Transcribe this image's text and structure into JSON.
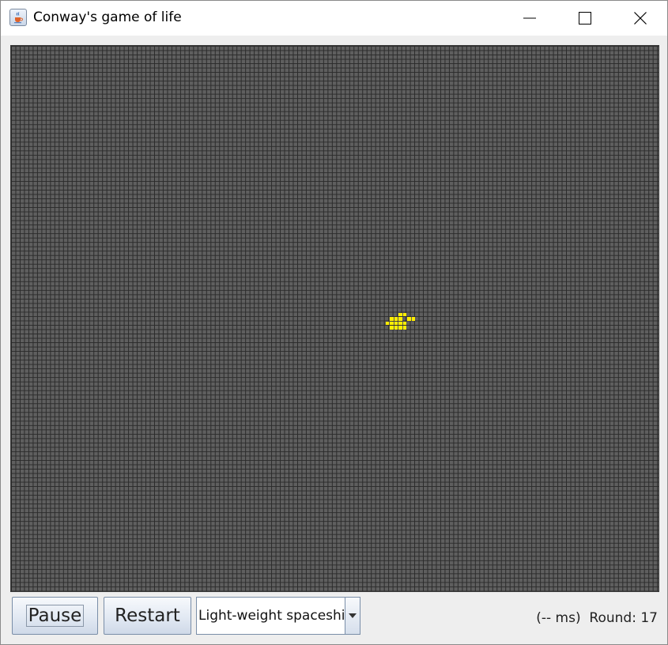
{
  "window": {
    "title": "Conway's game of life",
    "icon": "java-coffee-cup-icon",
    "controls": [
      "minimize-icon",
      "maximize-icon",
      "close-icon"
    ]
  },
  "board": {
    "columns": 149,
    "rows": 125,
    "dead_color": "#5f5f5f",
    "grid_color": "#2b2b2b",
    "live_color": "#ffee00",
    "live_cells": [
      [
        89,
        61
      ],
      [
        90,
        61
      ],
      [
        87,
        62
      ],
      [
        88,
        62
      ],
      [
        89,
        62
      ],
      [
        91,
        62
      ],
      [
        92,
        62
      ],
      [
        86,
        63
      ],
      [
        87,
        63
      ],
      [
        88,
        63
      ],
      [
        89,
        63
      ],
      [
        90,
        63
      ],
      [
        87,
        64
      ],
      [
        88,
        64
      ],
      [
        89,
        64
      ],
      [
        90,
        64
      ]
    ]
  },
  "controls": {
    "pause_label": "Pause",
    "restart_label": "Restart",
    "pattern_selected": "Light-weight spaceship"
  },
  "status": {
    "timing": "(-- ms)",
    "round_label": "Round:",
    "round_value": "17"
  }
}
